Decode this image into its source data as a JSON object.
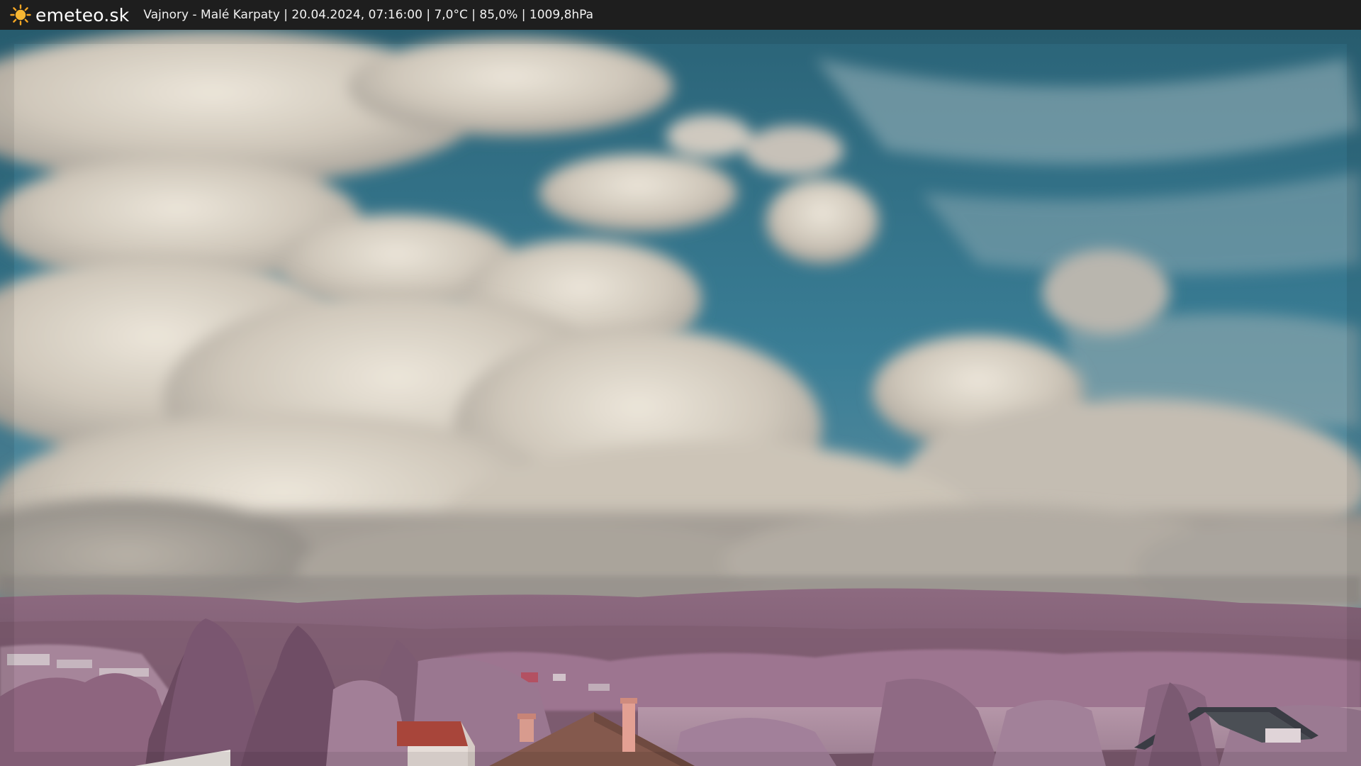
{
  "header": {
    "logo_icon": "sun-icon",
    "brand": "emeteo.sk",
    "caption": "Vajnory - Malé Karpaty | 20.04.2024, 07:16:00 | 7,0°C | 85,0% | 1009,8hPa"
  },
  "colors": {
    "topbar": "#1e1e1e",
    "sun": "#f5a623",
    "sky": "#2f6f86",
    "cloud": "#d8d2c6",
    "hills": "#8a607a",
    "field": "#b08ea3",
    "roof": "#a8453a"
  }
}
